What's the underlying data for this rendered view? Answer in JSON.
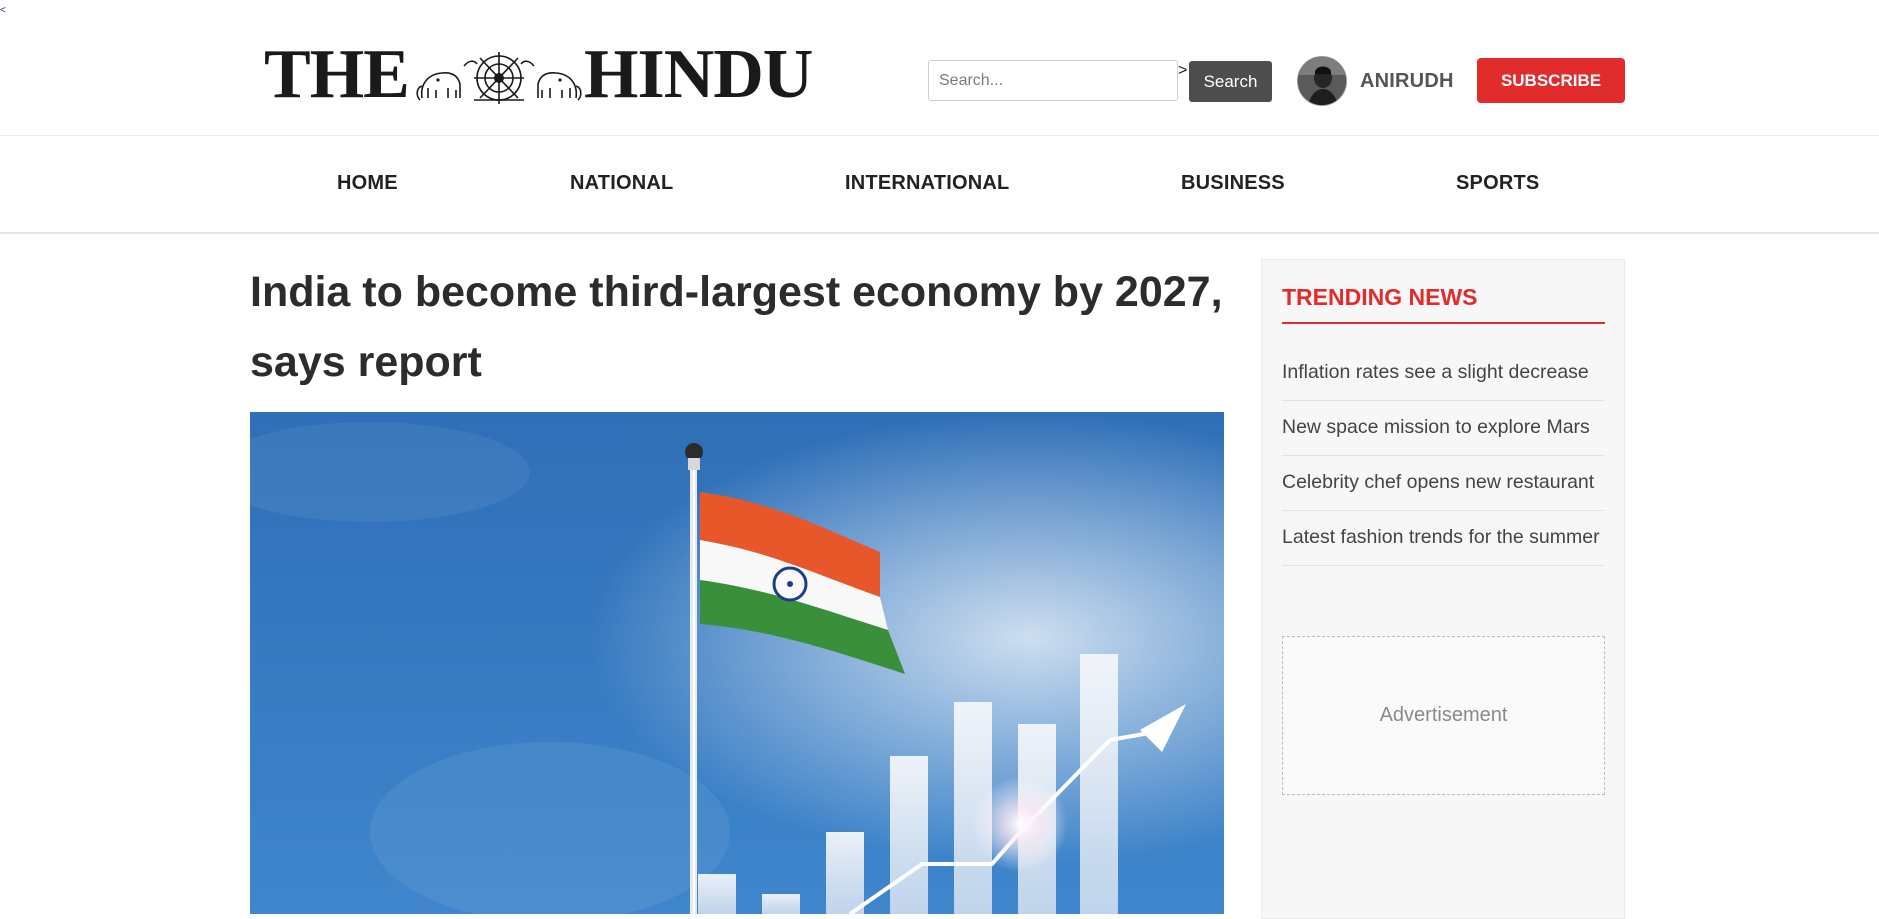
{
  "header": {
    "logo_text_left": "THE",
    "logo_text_right": "HINDU",
    "search": {
      "placeholder": "Search...",
      "value": "",
      "caret": ">",
      "button_label": "Search"
    },
    "user": {
      "name": "ANIRUDH"
    },
    "subscribe_label": "SUBSCRIBE"
  },
  "nav": {
    "items": [
      {
        "label": "HOME"
      },
      {
        "label": "NATIONAL"
      },
      {
        "label": "INTERNATIONAL"
      },
      {
        "label": "BUSINESS"
      },
      {
        "label": "SPORTS"
      }
    ]
  },
  "article": {
    "headline": "India to become third-largest economy by 2027, says report"
  },
  "sidebar": {
    "title": "TRENDING NEWS",
    "items": [
      {
        "label": "Inflation rates see a slight decrease"
      },
      {
        "label": "New space mission to explore Mars"
      },
      {
        "label": "Celebrity chef opens new restaurant"
      },
      {
        "label": "Latest fashion trends for the summer"
      }
    ],
    "ad_label": "Advertisement"
  },
  "colors": {
    "accent": "#e22c2c",
    "search_button": "#4d4d4d",
    "nav_text": "#222222",
    "sidebar_bg": "#f7f7f7"
  },
  "icons": [
    "logo-emblem-icon",
    "avatar"
  ]
}
